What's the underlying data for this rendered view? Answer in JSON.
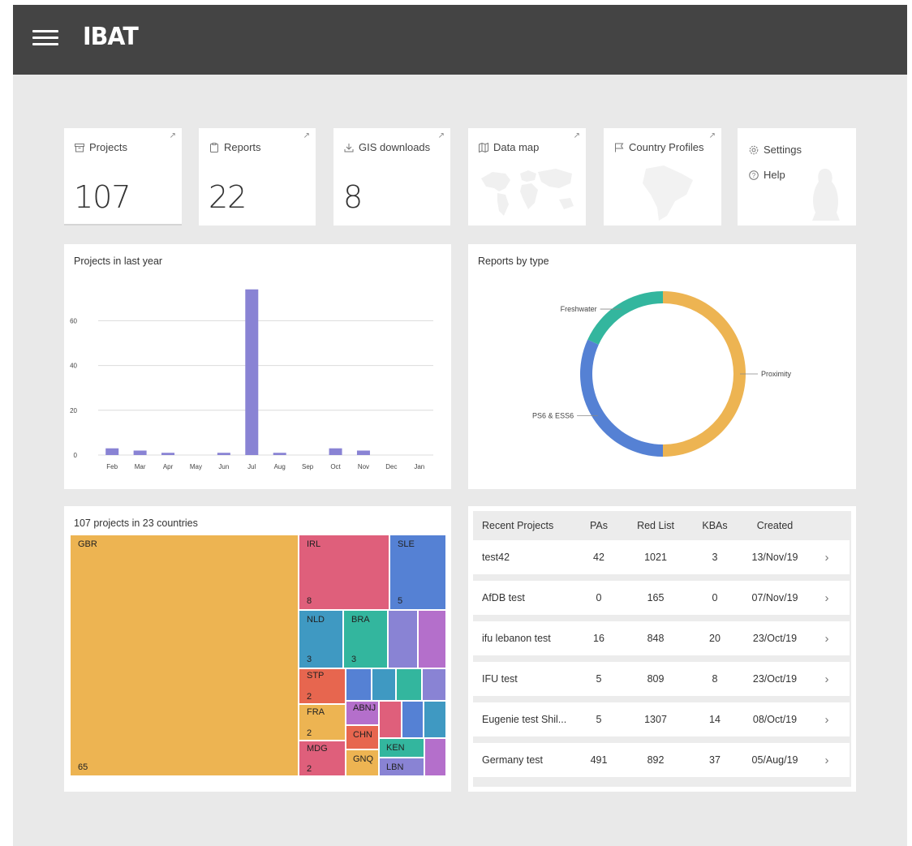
{
  "header": {
    "logo_text": "IBAT"
  },
  "stats": [
    {
      "label": "Projects",
      "value": "107",
      "icon": "archive-icon"
    },
    {
      "label": "Reports",
      "value": "22",
      "icon": "clipboard-icon"
    },
    {
      "label": "GIS downloads",
      "value": "8",
      "icon": "download-icon"
    },
    {
      "label": "Data map",
      "icon": "map-icon"
    },
    {
      "label": "Country Profiles",
      "icon": "flag-icon"
    }
  ],
  "settings_card": {
    "settings_label": "Settings",
    "help_label": "Help"
  },
  "projects_chart": {
    "title": "Projects in last year",
    "chart_data": {
      "type": "bar",
      "categories": [
        "Feb",
        "Mar",
        "Apr",
        "May",
        "Jun",
        "Jul",
        "Aug",
        "Sep",
        "Oct",
        "Nov",
        "Dec",
        "Jan"
      ],
      "values": [
        3,
        2,
        1,
        0,
        1,
        74,
        1,
        0,
        3,
        2,
        0,
        0
      ],
      "yticks": [
        0,
        20,
        40,
        60
      ],
      "ylim": [
        0,
        75
      ],
      "grid": true,
      "color": "#8983d4"
    }
  },
  "reports_chart": {
    "title": "Reports by type",
    "chart_data": {
      "type": "pie",
      "labels": [
        "Proximity",
        "PS6 & ESS6",
        "Freshwater"
      ],
      "values": [
        11,
        7,
        4
      ],
      "colors": [
        "#edb452",
        "#5581d4",
        "#33b69e"
      ],
      "donut": true
    }
  },
  "treemap": {
    "title": "107 projects in 23 countries",
    "chart_data": {
      "type": "treemap",
      "items": [
        {
          "code": "GBR",
          "value": "65",
          "color": "#edb452"
        },
        {
          "code": "IRL",
          "value": "8",
          "color": "#df5f7b"
        },
        {
          "code": "SLE",
          "value": "5",
          "color": "#5581d4"
        },
        {
          "code": "NLD",
          "value": "3",
          "color": "#3f99c2"
        },
        {
          "code": "BRA",
          "value": "3",
          "color": "#33b69e"
        },
        {
          "code": "STP",
          "value": "2",
          "color": "#e7664f"
        },
        {
          "code": "FRA",
          "value": "2",
          "color": "#edb452"
        },
        {
          "code": "MDG",
          "value": "2",
          "color": "#df5f7b"
        },
        {
          "code": "ABNJ",
          "value": "",
          "color": "#b46fcb"
        },
        {
          "code": "CHN",
          "value": "",
          "color": "#e7664f"
        },
        {
          "code": "GNQ",
          "value": "",
          "color": "#edb452"
        },
        {
          "code": "KEN",
          "value": "",
          "color": "#33b69e"
        },
        {
          "code": "LBN",
          "value": "",
          "color": "#8983d4"
        }
      ]
    }
  },
  "recent_projects": {
    "headers": {
      "name": "Recent Projects",
      "pas": "PAs",
      "red_list": "Red List",
      "kbas": "KBAs",
      "created": "Created"
    },
    "rows": [
      {
        "name": "test42",
        "pas": "42",
        "red_list": "1021",
        "kbas": "3",
        "created": "13/Nov/19"
      },
      {
        "name": "AfDB test",
        "pas": "0",
        "red_list": "165",
        "kbas": "0",
        "created": "07/Nov/19"
      },
      {
        "name": "ifu lebanon test",
        "pas": "16",
        "red_list": "848",
        "kbas": "20",
        "created": "23/Oct/19"
      },
      {
        "name": "IFU test",
        "pas": "5",
        "red_list": "809",
        "kbas": "8",
        "created": "23/Oct/19"
      },
      {
        "name": "Eugenie test Shil...",
        "pas": "5",
        "red_list": "1307",
        "kbas": "14",
        "created": "08/Oct/19"
      },
      {
        "name": "Germany test",
        "pas": "491",
        "red_list": "892",
        "kbas": "37",
        "created": "05/Aug/19"
      }
    ]
  }
}
